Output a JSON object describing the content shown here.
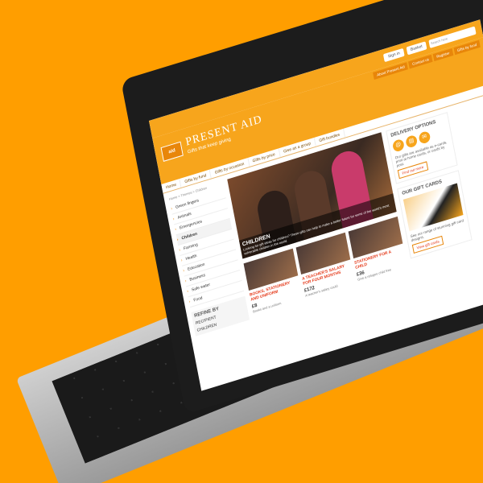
{
  "utility": {
    "sign_in": "Sign in",
    "basket": "Basket",
    "search_placeholder": "Search here"
  },
  "header": {
    "logo_text": "aid",
    "brand": "PRESENT AID",
    "tagline": "Gifts that keep giving",
    "topnav": [
      "About Present Aid",
      "Contact us",
      "Register"
    ],
    "gifts_tab": "Gifts by fund"
  },
  "mainnav": [
    "Home",
    "Gifts by fund",
    "Gifts by occasion",
    "Gifts by price",
    "Give as a group",
    "Gift bundles"
  ],
  "sidebar": {
    "breadcrumb": "Home > Themes > Children",
    "items": [
      {
        "label": "Green fingers",
        "active": false
      },
      {
        "label": "Animals",
        "active": false
      },
      {
        "label": "Emergencies",
        "active": false
      },
      {
        "label": "Children",
        "active": true
      },
      {
        "label": "Farming",
        "active": false
      },
      {
        "label": "Health",
        "active": false
      },
      {
        "label": "Education",
        "active": false
      },
      {
        "label": "Business",
        "active": false
      },
      {
        "label": "Safe water",
        "active": false
      },
      {
        "label": "Food",
        "active": false
      }
    ],
    "refine_title": "REFINE BY",
    "recipient": "RECIPIENT",
    "children": "CHILDREN"
  },
  "hero": {
    "title": "CHILDREN",
    "description": "Looking for gift ideas for children? These gifts can help to make a better future for some of the world's most vulnerable children in the world."
  },
  "cards": [
    {
      "title": "BOOKS, STATIONERY AND UNIFORM",
      "price": "£8",
      "sub": "Books and a uniform"
    },
    {
      "title": "A TEACHER'S SALARY FOR FOUR MONTHS",
      "price": "£172",
      "sub": "A teacher's salary could"
    },
    {
      "title": "STATIONERY FOR A CHILD",
      "price": "£36",
      "sub": "Give a refugee child free"
    }
  ],
  "delivery": {
    "title": "DELIVERY OPTIONS",
    "body": "Our gifts are available as e-cards, print at home cards, or cards by post.",
    "cta": "Find out more"
  },
  "giftcards": {
    "title": "OUR GIFT CARDS",
    "body": "See our range of stunning gift card designs.",
    "cta": "View gift cards"
  },
  "colors": {
    "brand_orange": "#F7A51C",
    "accent_red": "#E43A1A",
    "background": "#FF9E00"
  }
}
